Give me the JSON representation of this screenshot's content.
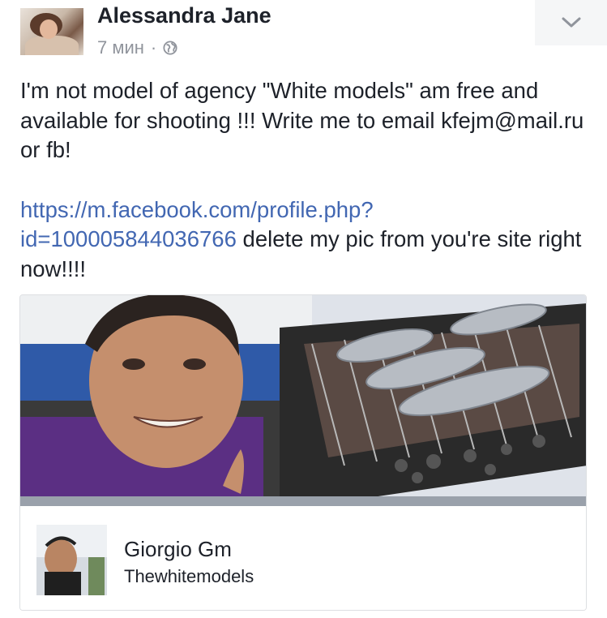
{
  "post": {
    "author": "Alessandra Jane",
    "time": "7 мин",
    "separator": "·",
    "privacy_icon": "globe-icon",
    "menu_icon": "chevron-down-icon",
    "text_line1": "I'm not model of agency \"White models\" am free and available for shooting !!! Write me to email kfejm@mail.ru or fb!",
    "link_text": "https://m.facebook.com/profile.php?id=100005844036766",
    "text_after_link": " delete my pic from you're site right now!!!!"
  },
  "shared": {
    "name": "Giorgio Gm",
    "subtitle": "Thewhitemodels"
  },
  "colors": {
    "link": "#4267b2",
    "text": "#1d2129",
    "meta": "#90949c"
  }
}
